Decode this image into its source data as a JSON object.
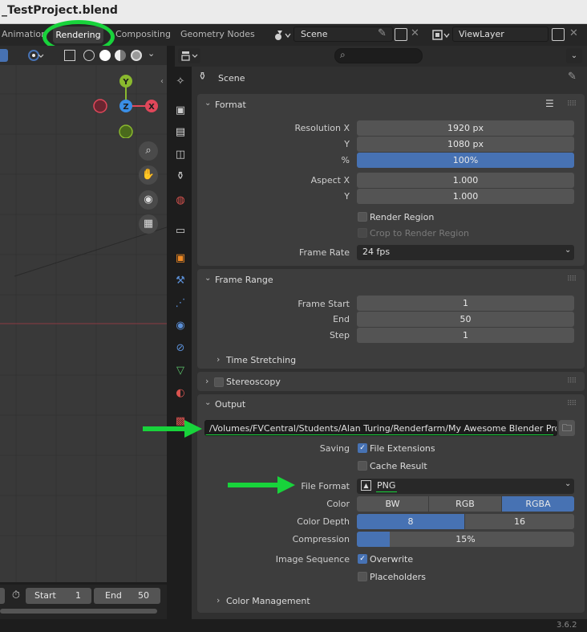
{
  "window": {
    "title": "_TestProject.blend"
  },
  "workspace_tabs": [
    {
      "label": "Animation"
    },
    {
      "label": "Rendering"
    },
    {
      "label": "Compositing"
    },
    {
      "label": "Geometry Nodes"
    }
  ],
  "scene_selector": {
    "value": "Scene"
  },
  "viewlayer_selector": {
    "value": "ViewLayer"
  },
  "gizmo": {
    "y": "Y",
    "z": "Z",
    "x": "X"
  },
  "context": {
    "title": "Scene"
  },
  "format": {
    "header": "Format",
    "resolution_x_label": "Resolution X",
    "resolution_x": "1920 px",
    "resolution_y_label": "Y",
    "resolution_y": "1080 px",
    "resolution_pct_label": "%",
    "resolution_pct": "100%",
    "aspect_x_label": "Aspect X",
    "aspect_x": "1.000",
    "aspect_y_label": "Y",
    "aspect_y": "1.000",
    "render_region": "Render Region",
    "crop_region": "Crop to Render Region",
    "frame_rate_label": "Frame Rate",
    "frame_rate": "24 fps"
  },
  "frame_range": {
    "header": "Frame Range",
    "start_label": "Frame Start",
    "start": "1",
    "end_label": "End",
    "end": "50",
    "step_label": "Step",
    "step": "1",
    "time_stretching": "Time Stretching"
  },
  "stereoscopy": {
    "header": "Stereoscopy"
  },
  "output": {
    "header": "Output",
    "path": "/Volumes/FVCentral/Students/Alan Turing/Renderfarm/My Awesome Blender Project/...",
    "saving_label": "Saving",
    "file_extensions": "File Extensions",
    "cache_result": "Cache Result",
    "file_format_label": "File Format",
    "file_format": "PNG",
    "color_label": "Color",
    "color_options": [
      "BW",
      "RGB",
      "RGBA"
    ],
    "color_selected": "RGBA",
    "depth_label": "Color Depth",
    "depth_options": [
      "8",
      "16"
    ],
    "depth_selected": "8",
    "compression_label": "Compression",
    "compression": "15%",
    "compression_value": 0.15,
    "sequence_label": "Image Sequence",
    "overwrite": "Overwrite",
    "placeholders": "Placeholders",
    "color_management": "Color Management"
  },
  "timeline": {
    "start_label": "Start",
    "start": "1",
    "end_label": "End",
    "end": "50"
  },
  "status": {
    "version": "3.6.2"
  },
  "colors": {
    "accent_blue": "#4772b3",
    "annotation_green": "#18d33b",
    "axis_x": "#e0475a",
    "axis_y": "#8ab92e",
    "axis_z": "#3a8ee6"
  }
}
